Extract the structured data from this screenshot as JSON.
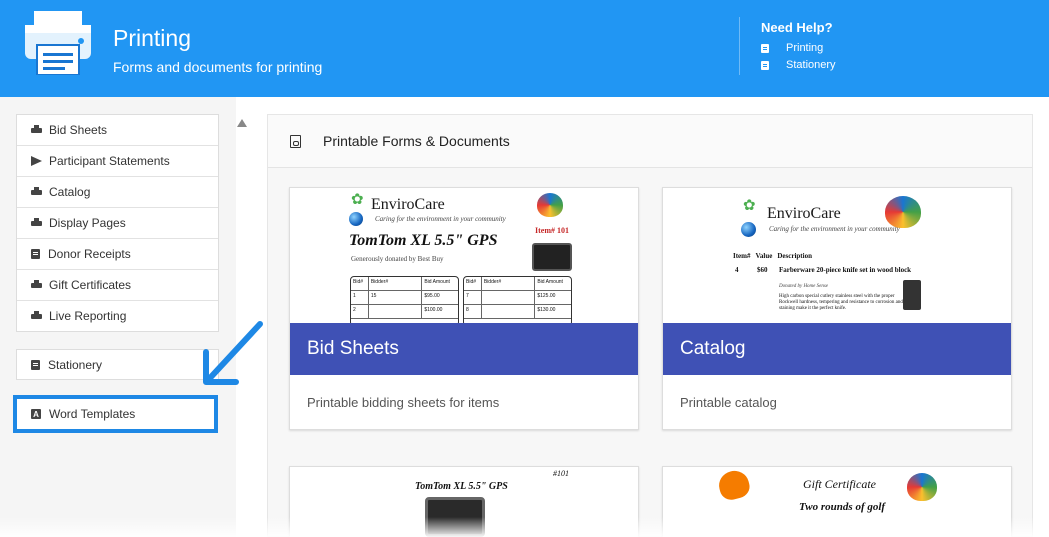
{
  "header": {
    "title": "Printing",
    "subtitle": "Forms and documents for printing",
    "help_title": "Need Help?",
    "help_links": [
      "Printing",
      "Stationery"
    ]
  },
  "sidebar": {
    "items": [
      {
        "label": "Bid Sheets",
        "icon": "print-icon"
      },
      {
        "label": "Participant Statements",
        "icon": "send-icon"
      },
      {
        "label": "Catalog",
        "icon": "print-icon"
      },
      {
        "label": "Display Pages",
        "icon": "print-icon"
      },
      {
        "label": "Donor Receipts",
        "icon": "document-icon"
      },
      {
        "label": "Gift Certificates",
        "icon": "print-icon"
      },
      {
        "label": "Live Reporting",
        "icon": "print-icon"
      }
    ],
    "stationery": "Stationery",
    "word_templates": "Word Templates"
  },
  "main": {
    "panel_title": "Printable Forms & Documents",
    "cards": [
      {
        "title": "Bid Sheets",
        "description": "Printable bidding sheets for items"
      },
      {
        "title": "Catalog",
        "description": "Printable catalog"
      }
    ],
    "thumbs": {
      "envirocare": "EnviroCare",
      "tagline": "Caring for the environment in your community",
      "gps": "TomTom XL 5.5\" GPS",
      "item_no": "Item# 101",
      "donated": "Generously donated by Best Buy",
      "col_bid": "Bid#",
      "col_bidder": "Bidder#",
      "col_amount": "Bid Amount",
      "rows_left": [
        [
          "1",
          "15",
          "$95.00"
        ],
        [
          "2",
          "",
          "$100.00"
        ]
      ],
      "rows_right": [
        [
          "7",
          "",
          "$125.00"
        ],
        [
          "8",
          "",
          "$130.00"
        ]
      ],
      "catalog_head": [
        "Item#",
        "Value",
        "Description"
      ],
      "catalog_item": [
        "4",
        "$60",
        "Farberware 20-piece knife set in wood block"
      ],
      "catalog_donor": "Donated by Home Sense",
      "catalog_text": "High carbon special cutlery stainless steel with the proper Rockwell hardness, tempering and resistance to corrosion and staining make it the perfect knife.",
      "gps2": "TomTom XL 5.5\" GPS",
      "item_no2": "#101",
      "gift_title": "Gift Certificate",
      "gift_sub": "Two rounds of golf"
    }
  },
  "colors": {
    "header_bg": "#2196f3",
    "card_band": "#3f51b5",
    "highlight": "#1e88e5"
  }
}
